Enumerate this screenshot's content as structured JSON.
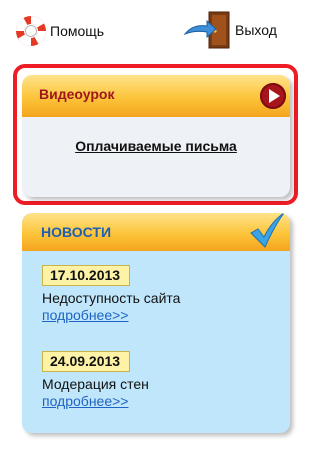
{
  "header": {
    "help_label": "Помощь",
    "exit_label": "Выход"
  },
  "video": {
    "title": "Видеоурок",
    "link": "Оплачиваемые письма"
  },
  "news": {
    "title": "НОВОСТИ",
    "items": [
      {
        "date": "17.10.2013",
        "text": "Недоступность сайта",
        "more": "подробнее>>"
      },
      {
        "date": "24.09.2013",
        "text": "Модерация стен",
        "more": "подробнее>>"
      }
    ]
  },
  "icons": {
    "help": "lifebuoy-icon",
    "exit": "exit-door-icon",
    "play": "play-icon",
    "check": "checkmark-icon"
  },
  "colors": {
    "highlight_border": "#ee1c25",
    "header_gold": "#fcc43a",
    "video_title": "#a0161b",
    "news_title": "#1e5fb4",
    "news_background": "#bfe6fa",
    "link": "#1f63c4"
  }
}
